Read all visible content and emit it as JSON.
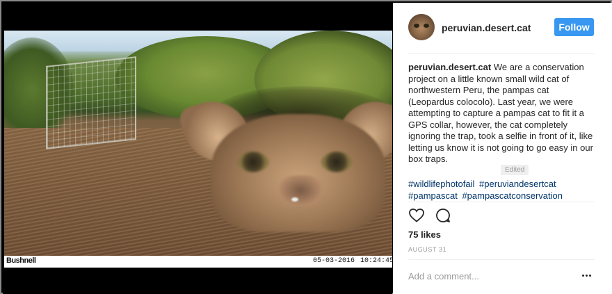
{
  "post": {
    "username": "peruvian.desert.cat",
    "follow_label": "Follow",
    "caption_author": "peruvian.desert.cat",
    "caption_text": "We are a conservation project on a little known small wild cat of northwestern Peru, the pampas cat (Leopardus colocolo). Last year, we were attempting to capture a pampas cat to fit it a GPS collar, however, the cat completely ignoring the trap, took a selfie in front of it, like letting us know it is not going to go easy in our box traps.",
    "edited_label": "Edited",
    "hashtags": [
      "#wildlifephotofail",
      "#peruviandesertcat",
      "#pampascat",
      "#pampascatconservation"
    ],
    "likes": "75 likes",
    "date": "AUGUST 31",
    "comment_placeholder": "Add a comment..."
  },
  "camera_overlay": {
    "brand": "Bushnell",
    "date": "05-03-2016",
    "time": "10:24:45"
  },
  "icons": {
    "like": "heart-icon",
    "comment": "comment-bubble-icon",
    "more": "more-options-icon"
  },
  "colors": {
    "follow_button": "#3897f0",
    "hashtag": "#003569",
    "text": "#262626",
    "muted": "#999999"
  }
}
